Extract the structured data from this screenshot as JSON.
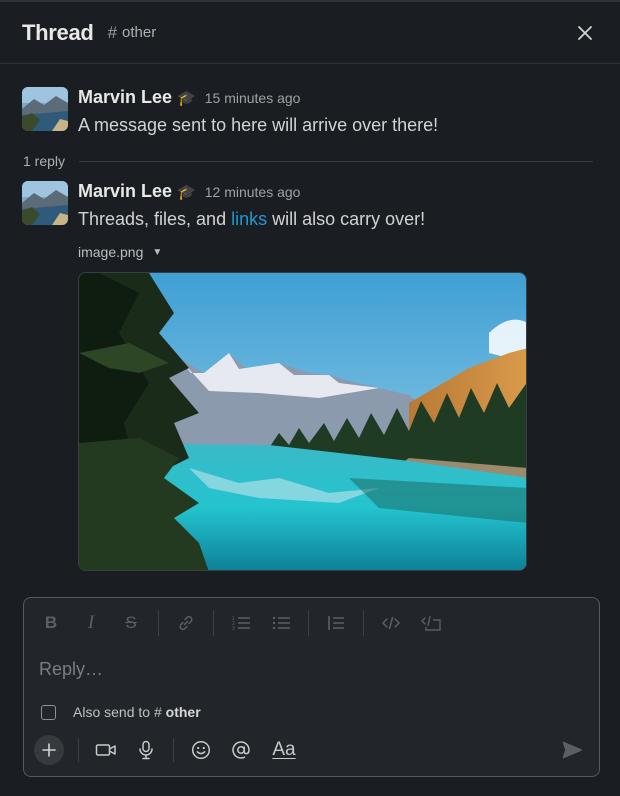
{
  "header": {
    "title": "Thread",
    "channel_hash": "#",
    "channel_name": "other"
  },
  "messages": [
    {
      "author": "Marvin Lee",
      "status_emoji": "🎓",
      "time": "15 minutes ago",
      "text": "A message sent to here will arrive over there!"
    },
    {
      "author": "Marvin Lee",
      "status_emoji": "🎓",
      "time": "12 minutes ago",
      "text_before": "Threads, files, and ",
      "link_text": "links",
      "text_after": " will also carry over!",
      "attachment": {
        "filename": "image.png",
        "caret": "▼"
      }
    }
  ],
  "replies": {
    "count_label": "1 reply"
  },
  "composer": {
    "placeholder": "Reply…",
    "also_send_prefix": "Also send to",
    "also_send_hash": "#",
    "also_send_channel": "other",
    "also_send_checked": false,
    "format_label": "Aa"
  },
  "colors": {
    "background": "#1a1d21",
    "link": "#1d9bd1",
    "composer_border": "#56595d"
  },
  "icons": {
    "toolbar": [
      "bold-icon",
      "italic-icon",
      "strikethrough-icon",
      "link-icon",
      "ordered-list-icon",
      "bulleted-list-icon",
      "blockquote-icon",
      "code-icon",
      "code-block-icon"
    ],
    "bottom": [
      "plus-icon",
      "video-icon",
      "microphone-icon",
      "emoji-icon",
      "mention-icon",
      "format-text-icon",
      "send-icon"
    ]
  }
}
